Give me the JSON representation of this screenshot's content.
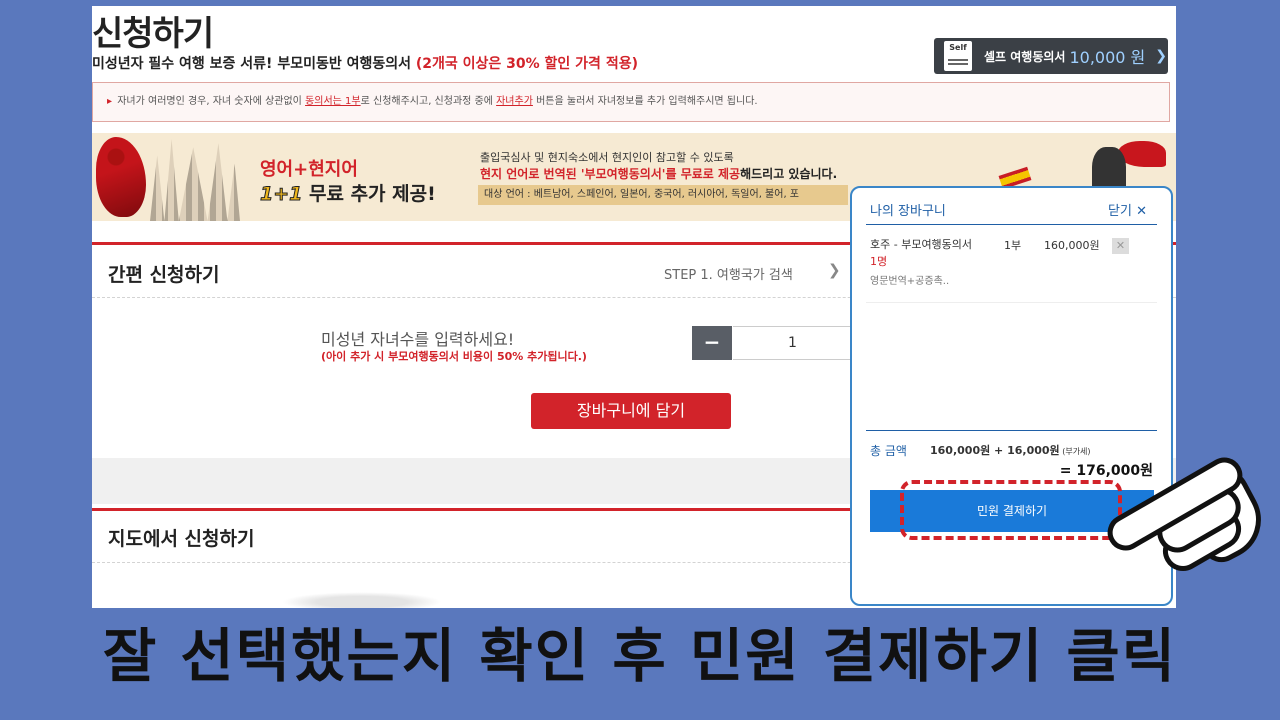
{
  "header": {
    "title": "신청하기",
    "subtitle_main": "미성년자 필수 여행 보증 서류! 부모미동반 여행동의서 ",
    "subtitle_highlight": "(2개국 이상은 30% 할인 가격 적용)"
  },
  "self_button": {
    "icon_text": "Self",
    "label": "셀프 여행동의서",
    "price": "10,000 원",
    "chevron": "❯"
  },
  "notice": {
    "arrow": "▸",
    "part1": " 자녀가 여러명인 경우, 자녀 숫자에 상관없이 ",
    "part2": "동의서는 1부",
    "part3": "로 신청해주시고, 신청과정 중에 ",
    "part4": "자녀추가",
    "part5": " 버튼을 눌러서 자녀정보를 추가 입력해주시면 됩니다."
  },
  "banner": {
    "heading1": "영어+현지어",
    "heading2_num": "1+1",
    "heading2_rest": " 무료 추가 제공!",
    "text1": "출입국심사 및 현지숙소에서  현지인이 참고할 수 있도록",
    "text2_red": "현지 언어로 번역된 '부모여행동의서'를 무료로 제공",
    "text2_rest": "해드리고 있습니다.",
    "languages": "대상 언어 : 베트남어, 스페인어, 일본어, 중국어, 러시아어, 독일어, 불어, 포"
  },
  "quick_apply": {
    "title": "간편 신청하기",
    "step": "STEP 1. 여행국가 검색",
    "step_arrow": "❯",
    "prompt": "미성년 자녀수를 입력하세요!",
    "prompt_note": "(아이 추가 시 부모여행동의서 비용이 50% 추가됩니다.)",
    "minus_label": "−",
    "quantity": "1",
    "cart_button": "장바구니에 담기"
  },
  "map_apply": {
    "title": "지도에서 신청하기"
  },
  "cart": {
    "title": "나의 장바구니",
    "close_label": "닫기 ✕",
    "item": {
      "name": "호주 - 부모여행동의서 ",
      "count": "1명",
      "option": "영문번역+공증촉..",
      "qty": "1부",
      "price": "160,000원",
      "delete": "✕"
    },
    "total_label": "총 금액",
    "total_calc": "160,000원 + 16,000원",
    "total_vat": " (부가세)",
    "total_final": "= 176,000원",
    "pay_button": "민원 결제하기"
  },
  "caption": "잘 선택했는지 확인 후 민원 결제하기 클릭",
  "colors": {
    "background": "#5a78bd",
    "accent_red": "#d2232a",
    "cart_blue": "#1a7ad9"
  }
}
